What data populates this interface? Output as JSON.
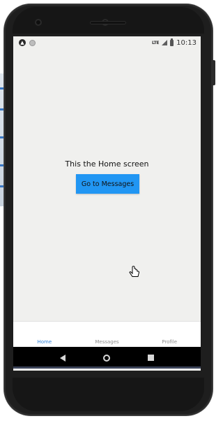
{
  "statusbar": {
    "network": "LTE",
    "time": "10:13"
  },
  "main": {
    "title": "This the Home screen",
    "button_label": "Go to Messages"
  },
  "tabs": [
    {
      "label": "Home",
      "active": true
    },
    {
      "label": "Messages",
      "active": false
    },
    {
      "label": "Profile",
      "active": false
    }
  ],
  "colors": {
    "primary_button": "#2196f3",
    "active_tab": "#2f80d6",
    "inactive_tab": "#8e8e8e",
    "screen_background": "#f0f0ee"
  },
  "icons": [
    "expo-icon",
    "notification-dot-icon",
    "signal-icon",
    "battery-icon",
    "back-icon",
    "home-icon",
    "recents-icon",
    "hand-cursor-icon"
  ]
}
